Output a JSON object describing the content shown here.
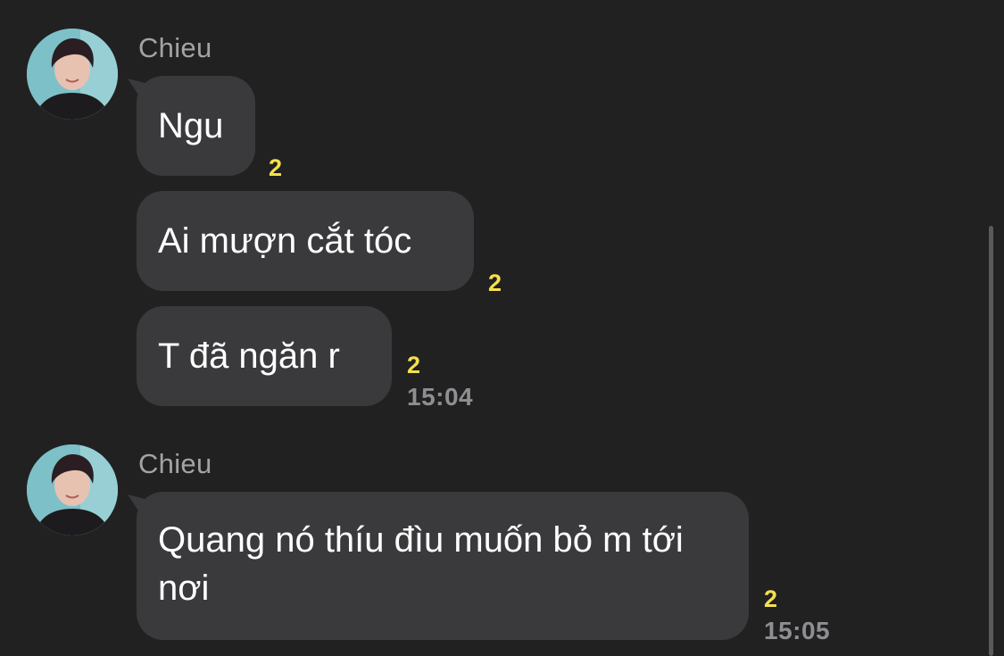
{
  "groups": [
    {
      "sender": "Chieu",
      "messages": [
        {
          "text": "Ngu",
          "read_count": "2",
          "time": ""
        },
        {
          "text": "Ai mượn cắt tóc",
          "read_count": "2",
          "time": ""
        },
        {
          "text": "T đã ngăn r",
          "read_count": "2",
          "time": "15:04"
        }
      ]
    },
    {
      "sender": "Chieu",
      "messages": [
        {
          "text": "Quang nó thíu đìu muốn bỏ m tới nơi",
          "read_count": "2",
          "time": "15:05"
        }
      ]
    }
  ],
  "colors": {
    "background": "#212121",
    "bubble": "#3a3a3c",
    "sender_name": "#a3a3a3",
    "read_count": "#f4e04d",
    "timestamp": "#8e8e93"
  },
  "icons": {
    "avatar": "profile-photo"
  }
}
